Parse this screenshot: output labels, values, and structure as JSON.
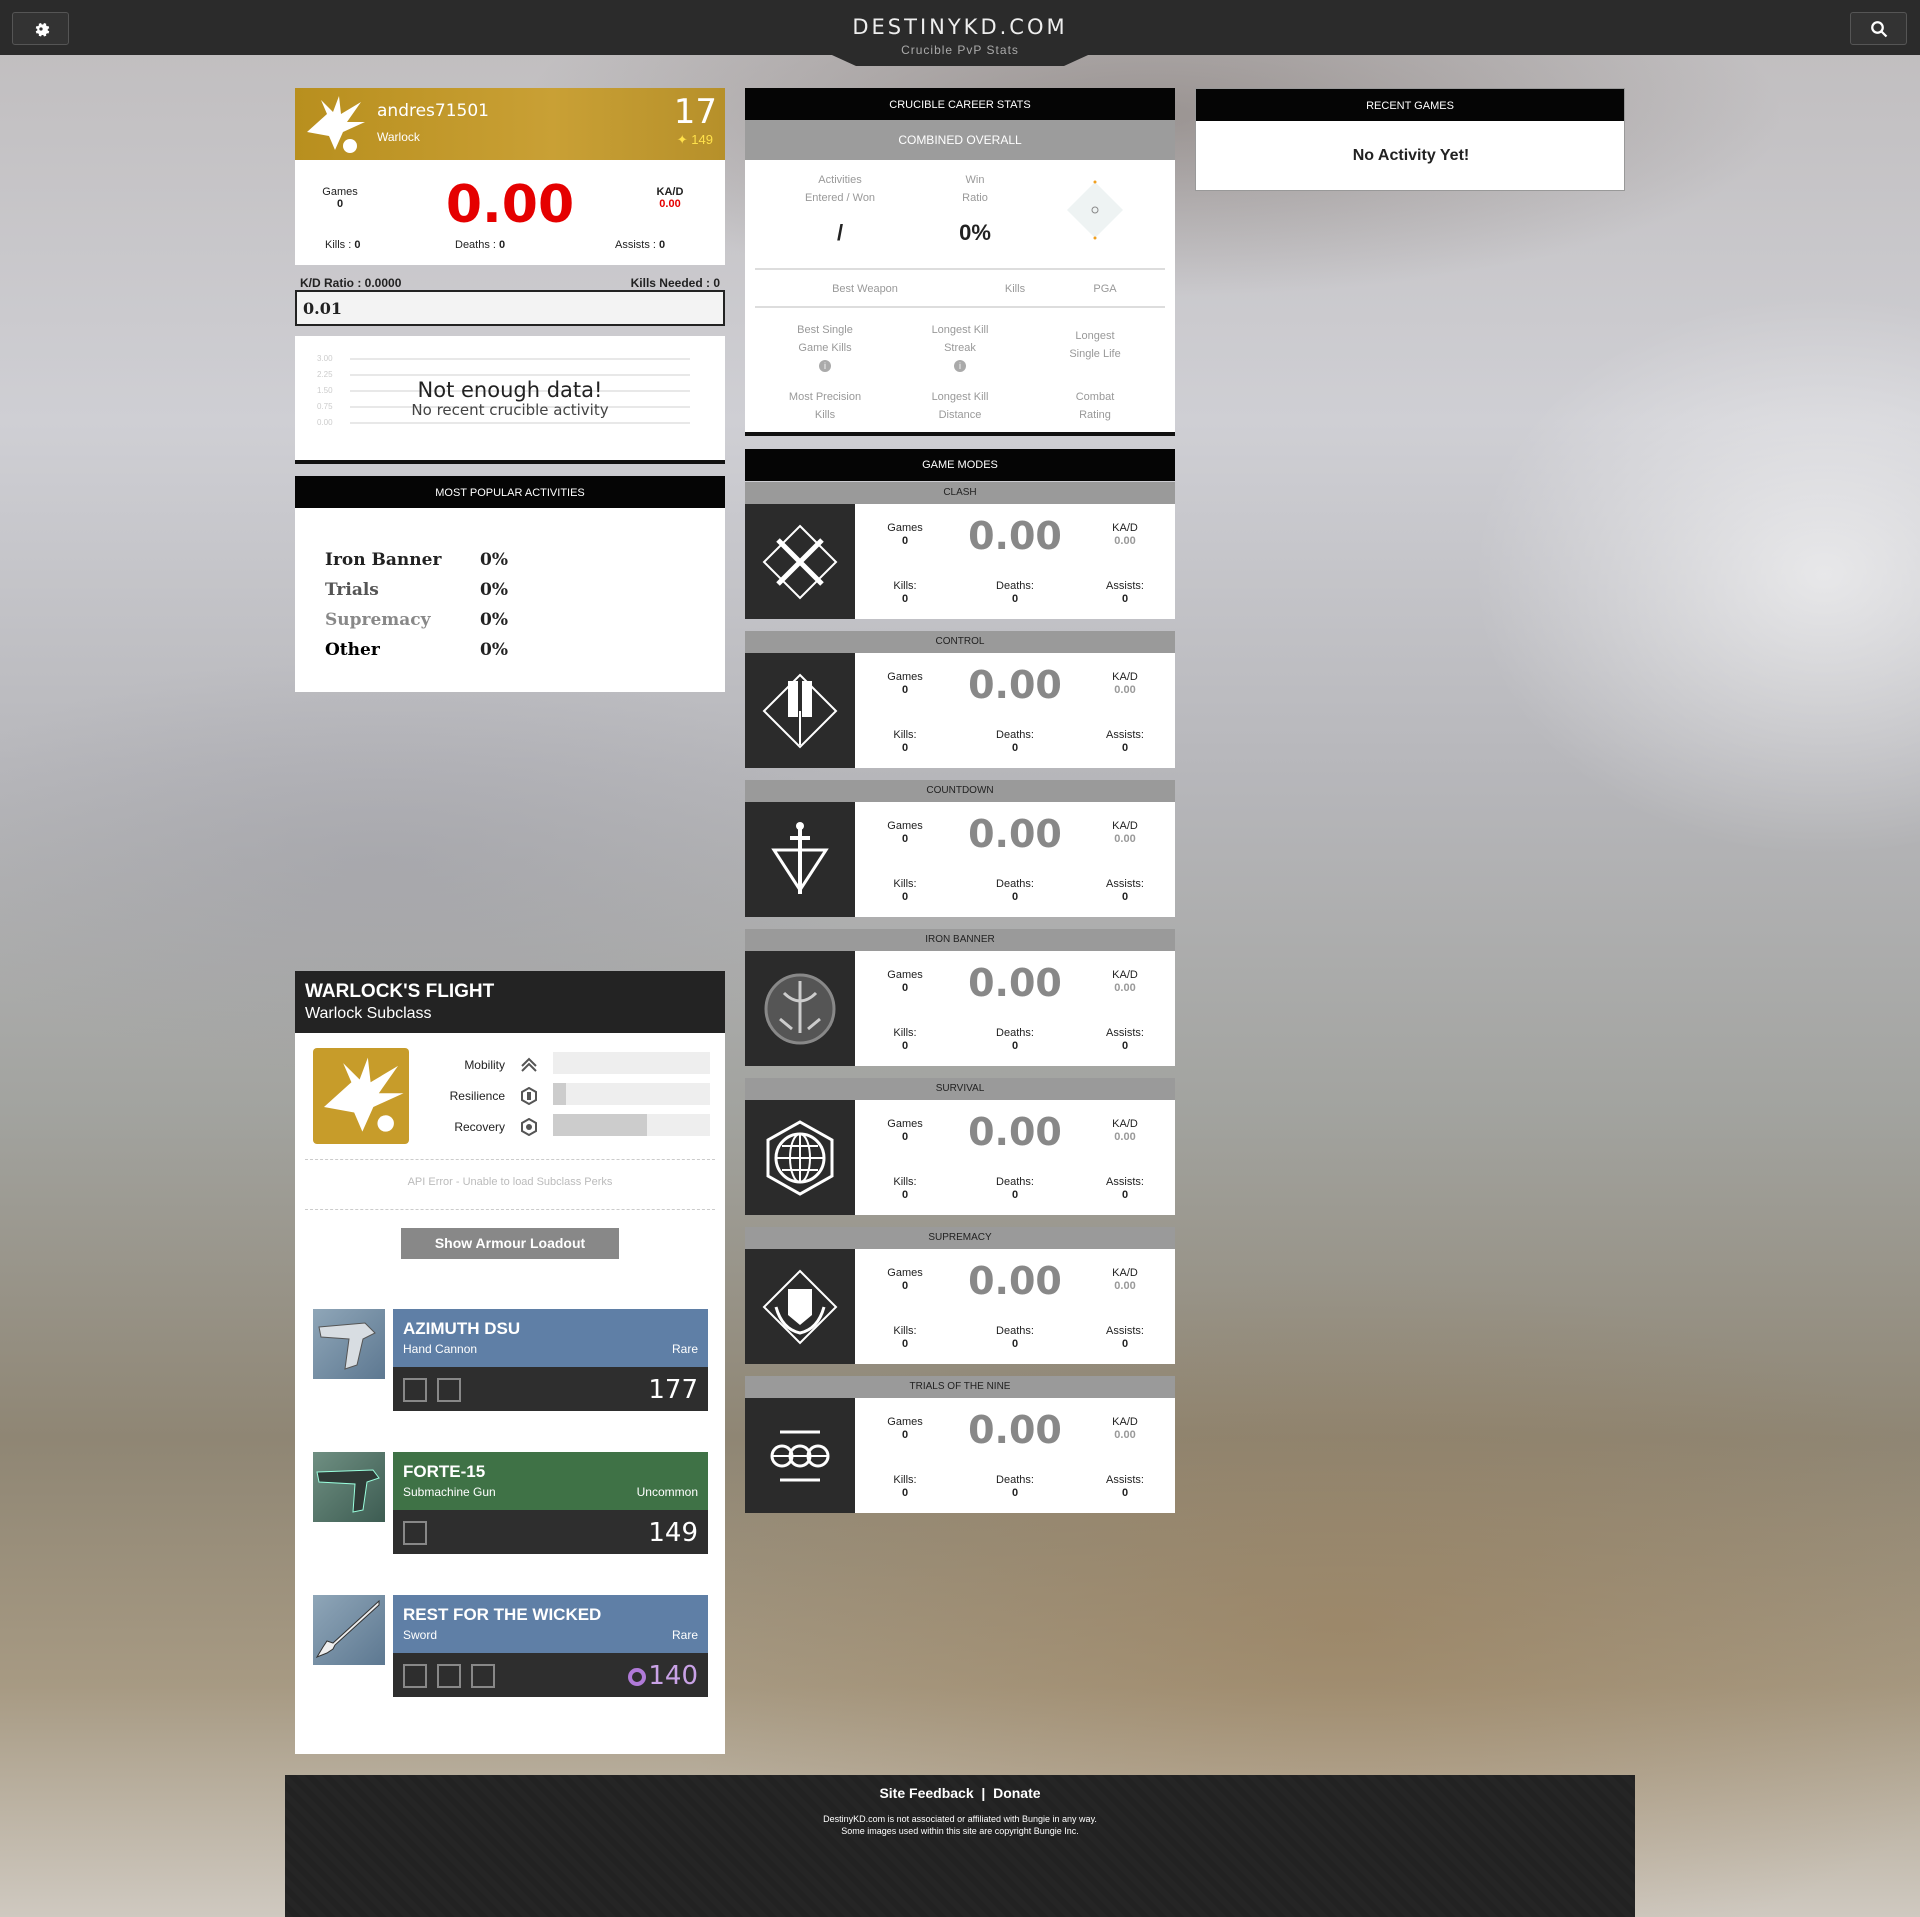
{
  "header": {
    "title": "DESTINYKD.COM",
    "subtitle": "Crucible PvP Stats",
    "settings_icon": "gear-icon",
    "search_icon": "search-icon"
  },
  "profile": {
    "name": "andres71501",
    "class": "Warlock",
    "level": "17",
    "light": "✦ 149",
    "games_label": "Games",
    "games": "0",
    "kd_big": "0.00",
    "kad_label": "KA/D",
    "kad": "0.00",
    "kills_label": "Kills :",
    "kills": "0",
    "deaths_label": "Deaths :",
    "deaths": "0",
    "assists_label": "Assists :",
    "assists": "0",
    "kd_ratio_label": "K/D Ratio : 0.0000",
    "kills_needed_label": "Kills Needed : 0",
    "target_input": "0.01"
  },
  "chart": {
    "ticks": [
      "3.00",
      "2.25",
      "1.50",
      "0.75",
      "0.00"
    ],
    "title": "Not enough data!",
    "subtitle": "No recent crucible activity"
  },
  "popular": {
    "title": "MOST POPULAR ACTIVITIES",
    "rows": [
      {
        "name": "Iron Banner",
        "pct": "0%",
        "color": "#222"
      },
      {
        "name": "Trials",
        "pct": "0%",
        "color": "#555"
      },
      {
        "name": "Supremacy",
        "pct": "0%",
        "color": "#888"
      },
      {
        "name": "Other",
        "pct": "0%",
        "color": "#000"
      }
    ]
  },
  "subclass": {
    "name": "WARLOCK'S FLIGHT",
    "type": "Warlock Subclass",
    "stats": [
      {
        "label": "Mobility",
        "fill": 0.0,
        "icon": "mobility-icon"
      },
      {
        "label": "Resilience",
        "fill": 0.08,
        "icon": "resilience-icon"
      },
      {
        "label": "Recovery",
        "fill": 0.6,
        "icon": "recovery-icon"
      }
    ],
    "api_error": "API Error - Unable to load Subclass Perks",
    "armour_button": "Show Armour Loadout"
  },
  "weapons": [
    {
      "name": "AZIMUTH DSU",
      "type": "Hand Cannon",
      "rarity": "Rare",
      "power": "177",
      "perks": 2,
      "color": "#5f7fa6"
    },
    {
      "name": "FORTE-15",
      "type": "Submachine Gun",
      "rarity": "Uncommon",
      "power": "149",
      "perks": 1,
      "color": "#3f7246"
    },
    {
      "name": "REST FOR THE WICKED",
      "type": "Sword",
      "rarity": "Rare",
      "power": "140",
      "perks": 3,
      "color": "#5f7fa6"
    }
  ],
  "career": {
    "title": "CRUCIBLE CAREER STATS",
    "combined": "COMBINED OVERALL",
    "activities_label_1": "Activities",
    "activities_label_2": "Entered / Won",
    "activities_value": "/",
    "win_label_1": "Win",
    "win_label_2": "Ratio",
    "win_value": "0%",
    "best_weapon": "Best Weapon",
    "kills": "Kills",
    "pga": "PGA",
    "bsgk_1": "Best Single",
    "bsgk_2": "Game Kills",
    "lks_1": "Longest Kill",
    "lks_2": "Streak",
    "lsl_1": "Longest",
    "lsl_2": "Single Life",
    "mpk_1": "Most Precision",
    "mpk_2": "Kills",
    "lkd_1": "Longest Kill",
    "lkd_2": "Distance",
    "cr_1": "Combat",
    "cr_2": "Rating"
  },
  "game_modes": {
    "title": "GAME MODES",
    "labels": {
      "games": "Games",
      "kad": "KA/D",
      "kills": "Kills:",
      "deaths": "Deaths:",
      "assists": "Assists:"
    },
    "modes": [
      {
        "name": "CLASH",
        "icon": "crossed-swords-icon",
        "games": "0",
        "kd": "0.00",
        "kad": "0.00",
        "kills": "0",
        "deaths": "0",
        "assists": "0"
      },
      {
        "name": "CONTROL",
        "icon": "control-flag-icon",
        "games": "0",
        "kd": "0.00",
        "kad": "0.00",
        "kills": "0",
        "deaths": "0",
        "assists": "0"
      },
      {
        "name": "COUNTDOWN",
        "icon": "countdown-dagger-icon",
        "games": "0",
        "kd": "0.00",
        "kad": "0.00",
        "kills": "0",
        "deaths": "0",
        "assists": "0"
      },
      {
        "name": "IRON BANNER",
        "icon": "iron-banner-icon",
        "games": "0",
        "kd": "0.00",
        "kad": "0.00",
        "kills": "0",
        "deaths": "0",
        "assists": "0"
      },
      {
        "name": "SURVIVAL",
        "icon": "survival-globe-icon",
        "games": "0",
        "kd": "0.00",
        "kad": "0.00",
        "kills": "0",
        "deaths": "0",
        "assists": "0"
      },
      {
        "name": "SUPREMACY",
        "icon": "supremacy-crest-icon",
        "games": "0",
        "kd": "0.00",
        "kad": "0.00",
        "kills": "0",
        "deaths": "0",
        "assists": "0"
      },
      {
        "name": "TRIALS OF THE NINE",
        "icon": "trials-eye-icon",
        "games": "0",
        "kd": "0.00",
        "kad": "0.00",
        "kills": "0",
        "deaths": "0",
        "assists": "0"
      }
    ]
  },
  "recent": {
    "title": "RECENT GAMES",
    "empty": "No Activity Yet!"
  },
  "footer": {
    "feedback": "Site Feedback",
    "separator": "|",
    "donate": "Donate",
    "disclaimer_1": "DestinyKD.com is not associated or affiliated with Bungie in any way.",
    "disclaimer_2": "Some images used within this site are copyright Bungie Inc."
  }
}
